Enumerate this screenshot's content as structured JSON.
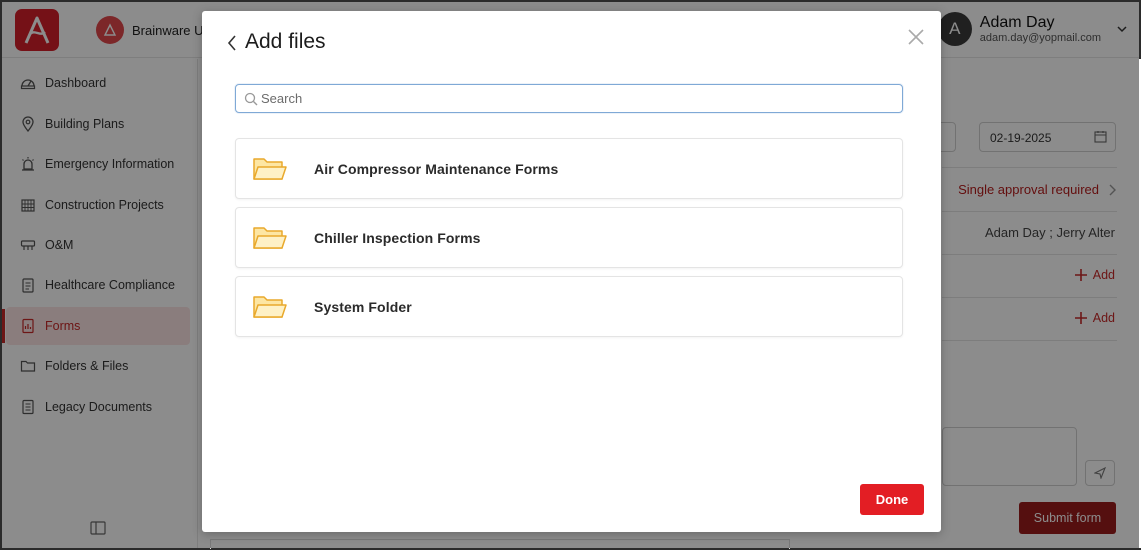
{
  "header": {
    "org_name": "Brainware Ur",
    "user": {
      "initial": "A",
      "name": "Adam Day",
      "email": "adam.day@yopmail.com"
    }
  },
  "sidebar": {
    "items": [
      {
        "label": "Dashboard",
        "icon": "dashboard-icon"
      },
      {
        "label": "Building Plans",
        "icon": "location-pin-icon"
      },
      {
        "label": "Emergency Information",
        "icon": "alarm-icon"
      },
      {
        "label": "Construction Projects",
        "icon": "building-icon"
      },
      {
        "label": "O&M",
        "icon": "wrench-icon"
      },
      {
        "label": "Healthcare Compliance",
        "icon": "clipboard-icon"
      },
      {
        "label": "Forms",
        "icon": "form-icon",
        "active": true
      },
      {
        "label": "Folders & Files",
        "icon": "folder-icon"
      },
      {
        "label": "Legacy Documents",
        "icon": "documents-icon"
      }
    ]
  },
  "right_panel": {
    "date": "02-19-2025",
    "approval": "Single approval required",
    "approvers": "Adam Day ;   Jerry Alter",
    "add_label_1": "Add",
    "add_label_2": "Add",
    "submit": "Submit form"
  },
  "modal": {
    "title": "Add files",
    "search": {
      "placeholder": "Search",
      "value": ""
    },
    "folders": [
      {
        "name": "Air Compressor Maintenance Forms"
      },
      {
        "name": "Chiller Inspection Forms"
      },
      {
        "name": "System Folder"
      }
    ],
    "done_label": "Done"
  },
  "colors": {
    "brand_red": "#d6202a",
    "done_button": "#e31e24",
    "submit_button": "#9c1c1c",
    "folder_fill": "#fde6a3",
    "folder_stroke": "#e9a92c",
    "search_border": "#7fa9d6"
  }
}
